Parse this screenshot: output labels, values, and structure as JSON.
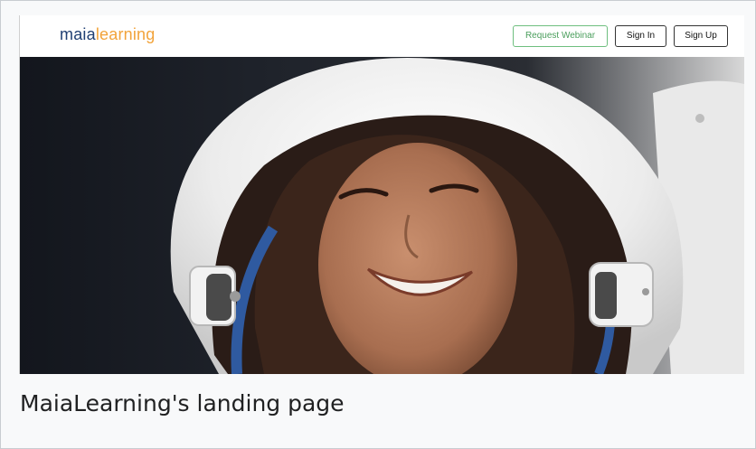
{
  "brand": {
    "name_part1": "maia",
    "name_part2": "learning"
  },
  "nav": {
    "request_webinar": "Request Webinar",
    "sign_in": "Sign In",
    "sign_up": "Sign Up"
  },
  "colors": {
    "logo_dark": "#1f3f73",
    "logo_orange": "#f2a33a",
    "webinar_green": "#4a9e5c"
  },
  "caption": "MaiaLearning's landing page"
}
